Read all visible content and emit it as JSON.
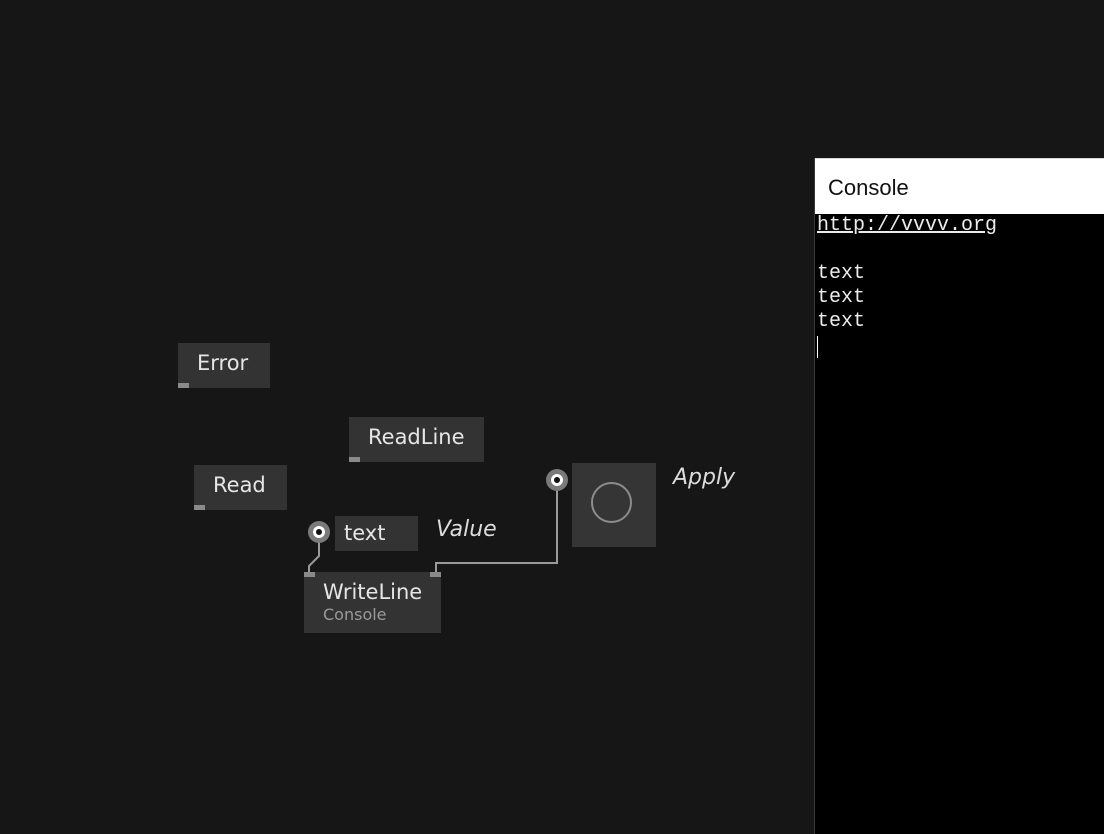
{
  "nodes": {
    "error": {
      "label": "Error"
    },
    "readline": {
      "label": "ReadLine"
    },
    "read": {
      "label": "Read"
    },
    "writeline": {
      "label": "WriteLine",
      "category": "Console"
    }
  },
  "iobox_text": {
    "value": "text",
    "pad_label": "Value"
  },
  "bang": {
    "pad_label": "Apply"
  },
  "console": {
    "title": "Console",
    "link": "http://vvvv.org",
    "lines": [
      "text",
      "text",
      "text"
    ]
  },
  "colors": {
    "background": "#161616",
    "node": "#333333",
    "pin": "#8a8a8a",
    "link": "#9a9a9a",
    "console_bg": "#000000"
  }
}
